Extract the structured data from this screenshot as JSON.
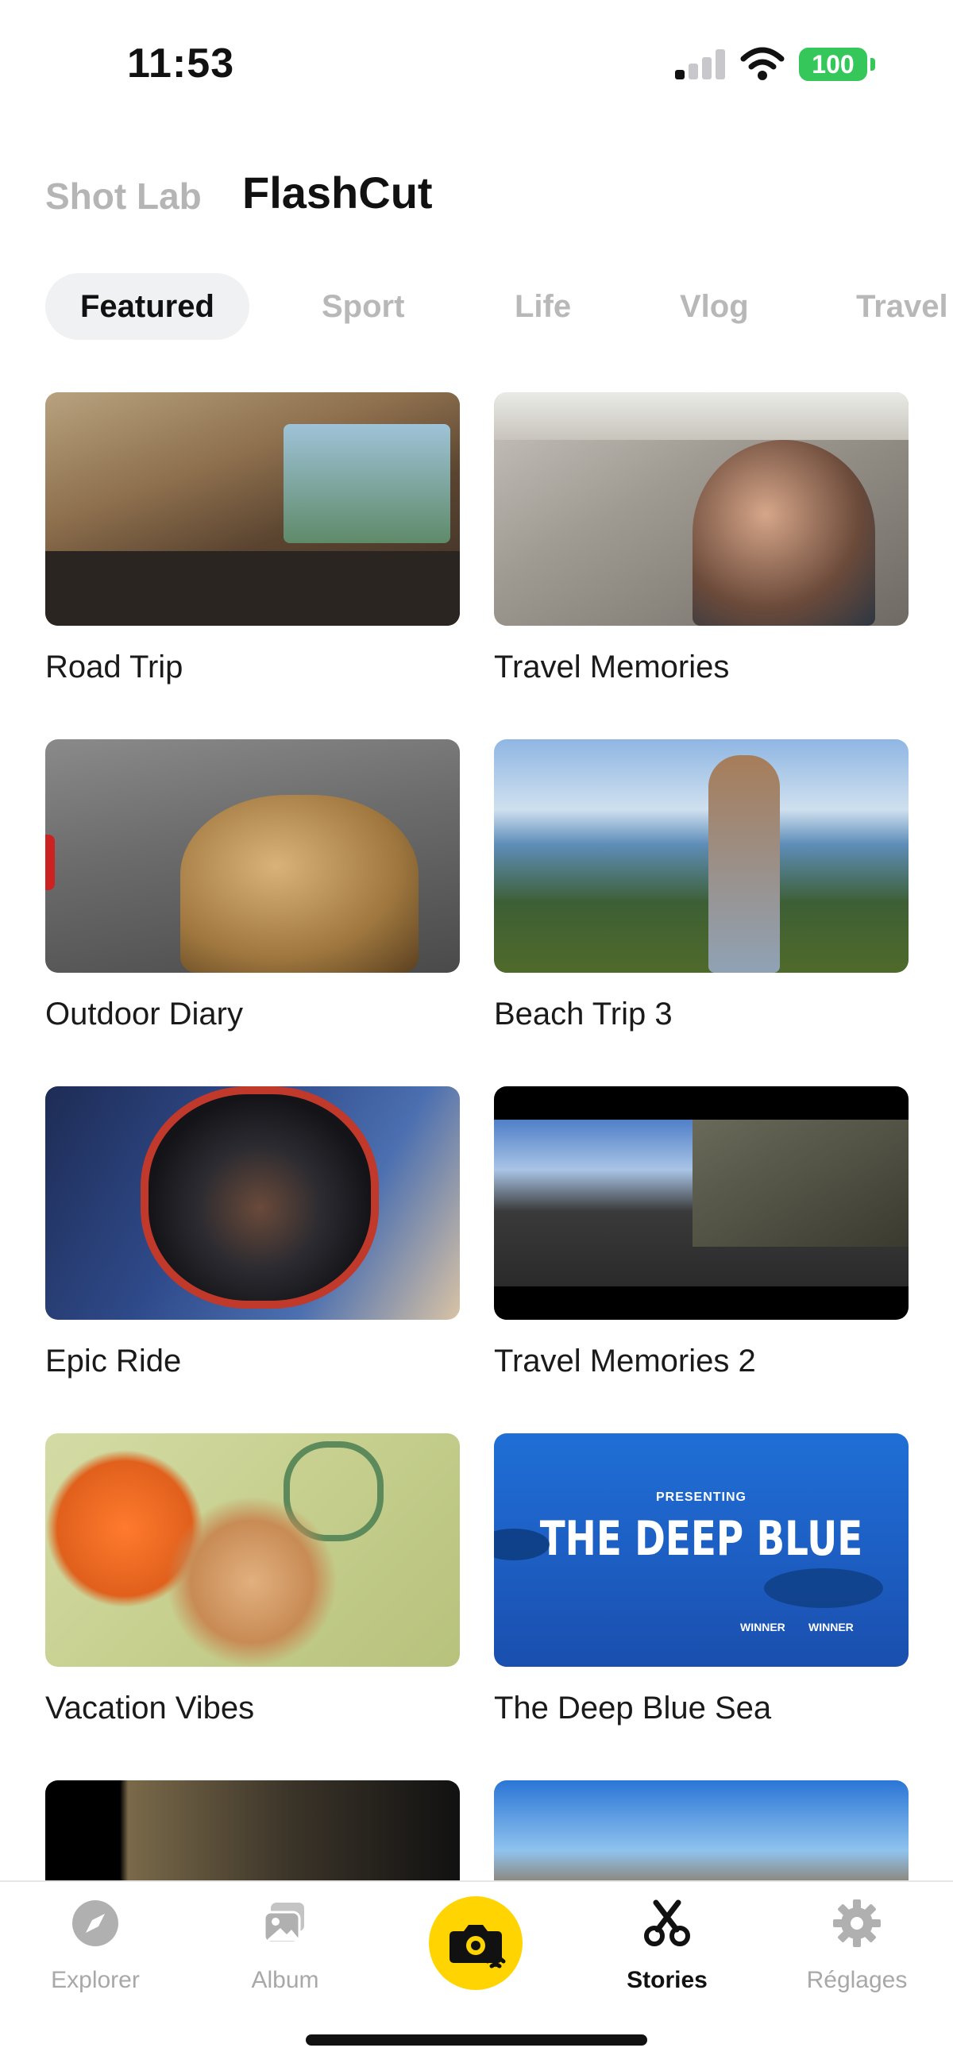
{
  "status": {
    "time": "11:53",
    "battery": "100"
  },
  "header": {
    "tab_shotlab": "Shot Lab",
    "tab_flashcut": "FlashCut"
  },
  "categories": [
    "Featured",
    "Sport",
    "Life",
    "Vlog",
    "Travel"
  ],
  "templates": [
    {
      "title": "Road Trip"
    },
    {
      "title": "Travel Memories"
    },
    {
      "title": "Outdoor Diary"
    },
    {
      "title": "Beach Trip 3"
    },
    {
      "title": "Epic Ride"
    },
    {
      "title": "Travel Memories 2"
    },
    {
      "title": "Vacation Vibes"
    },
    {
      "title": "The Deep Blue Sea",
      "thumb_text_small": "PRESENTING",
      "thumb_text_big": "THE DEEP BLUE",
      "award1": "WINNER",
      "award2": "WINNER"
    }
  ],
  "nav": {
    "explorer": "Explorer",
    "album": "Album",
    "stories": "Stories",
    "settings": "Réglages"
  },
  "icons": {
    "explorer": "compass-icon",
    "album": "album-icon",
    "camera": "camera-icon",
    "stories": "scissors-icon",
    "settings": "gear-icon"
  },
  "colors": {
    "accent": "#ffd400",
    "battery": "#35c759"
  }
}
